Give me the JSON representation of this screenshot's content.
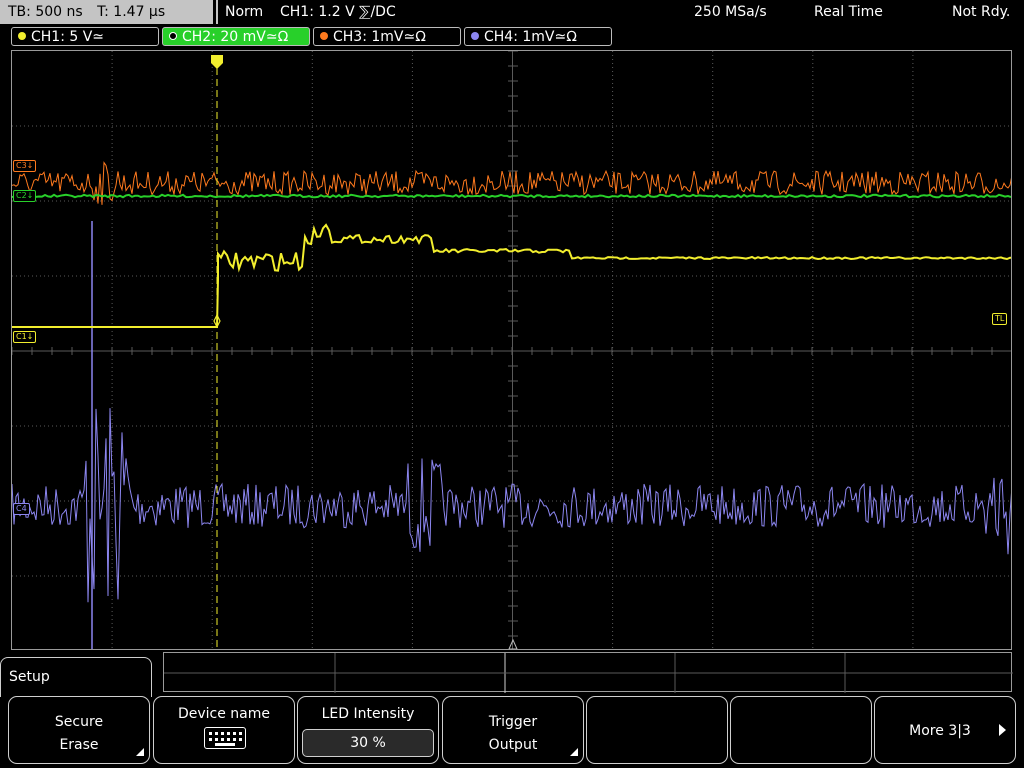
{
  "status_bar": {
    "timebase": "TB: 500 ns",
    "trigger_time": "T: 1.47 µs",
    "mode": "Norm",
    "trigger_info": "CH1: 1.2 V ⅀/DC",
    "sample_rate": "250 MSa/s",
    "acq_mode": "Real Time",
    "state": "Not Rdy."
  },
  "channels": [
    {
      "label": "CH1: 5 V≃",
      "color": "#f2ee2e",
      "active": false
    },
    {
      "label": "CH2: 20 mV≃Ω",
      "color": "#28d02a",
      "active": true
    },
    {
      "label": "CH3: 1mV≃Ω",
      "color": "#ff7a1e",
      "active": false
    },
    {
      "label": "CH4: 1mV≃Ω",
      "color": "#8c86f0",
      "active": false
    }
  ],
  "markers": {
    "c3": "C3↓",
    "c2": "C2↓",
    "c1": "C1↓",
    "c4": "C4",
    "trigger_level": "TL",
    "trigger_pos": "T"
  },
  "menu": {
    "title": "Setup",
    "softkeys": [
      {
        "line1": "Secure",
        "line2": "Erase",
        "has_submenu": true
      },
      {
        "line1": "Device name",
        "icon": "keyboard-icon"
      },
      {
        "line1": "LED Intensity",
        "value": "30 %"
      },
      {
        "line1": "Trigger",
        "line2": "Output",
        "has_submenu": true
      },
      {
        "line1": ""
      },
      {
        "line1": ""
      },
      {
        "line1": "More 3|3",
        "icon": "arrow-right-icon"
      }
    ]
  },
  "colors": {
    "ch1": "#f2ee2e",
    "ch2": "#28d02a",
    "ch3": "#ff7a1e",
    "ch4": "#8c86f0",
    "grid": "#5a5a5a"
  }
}
